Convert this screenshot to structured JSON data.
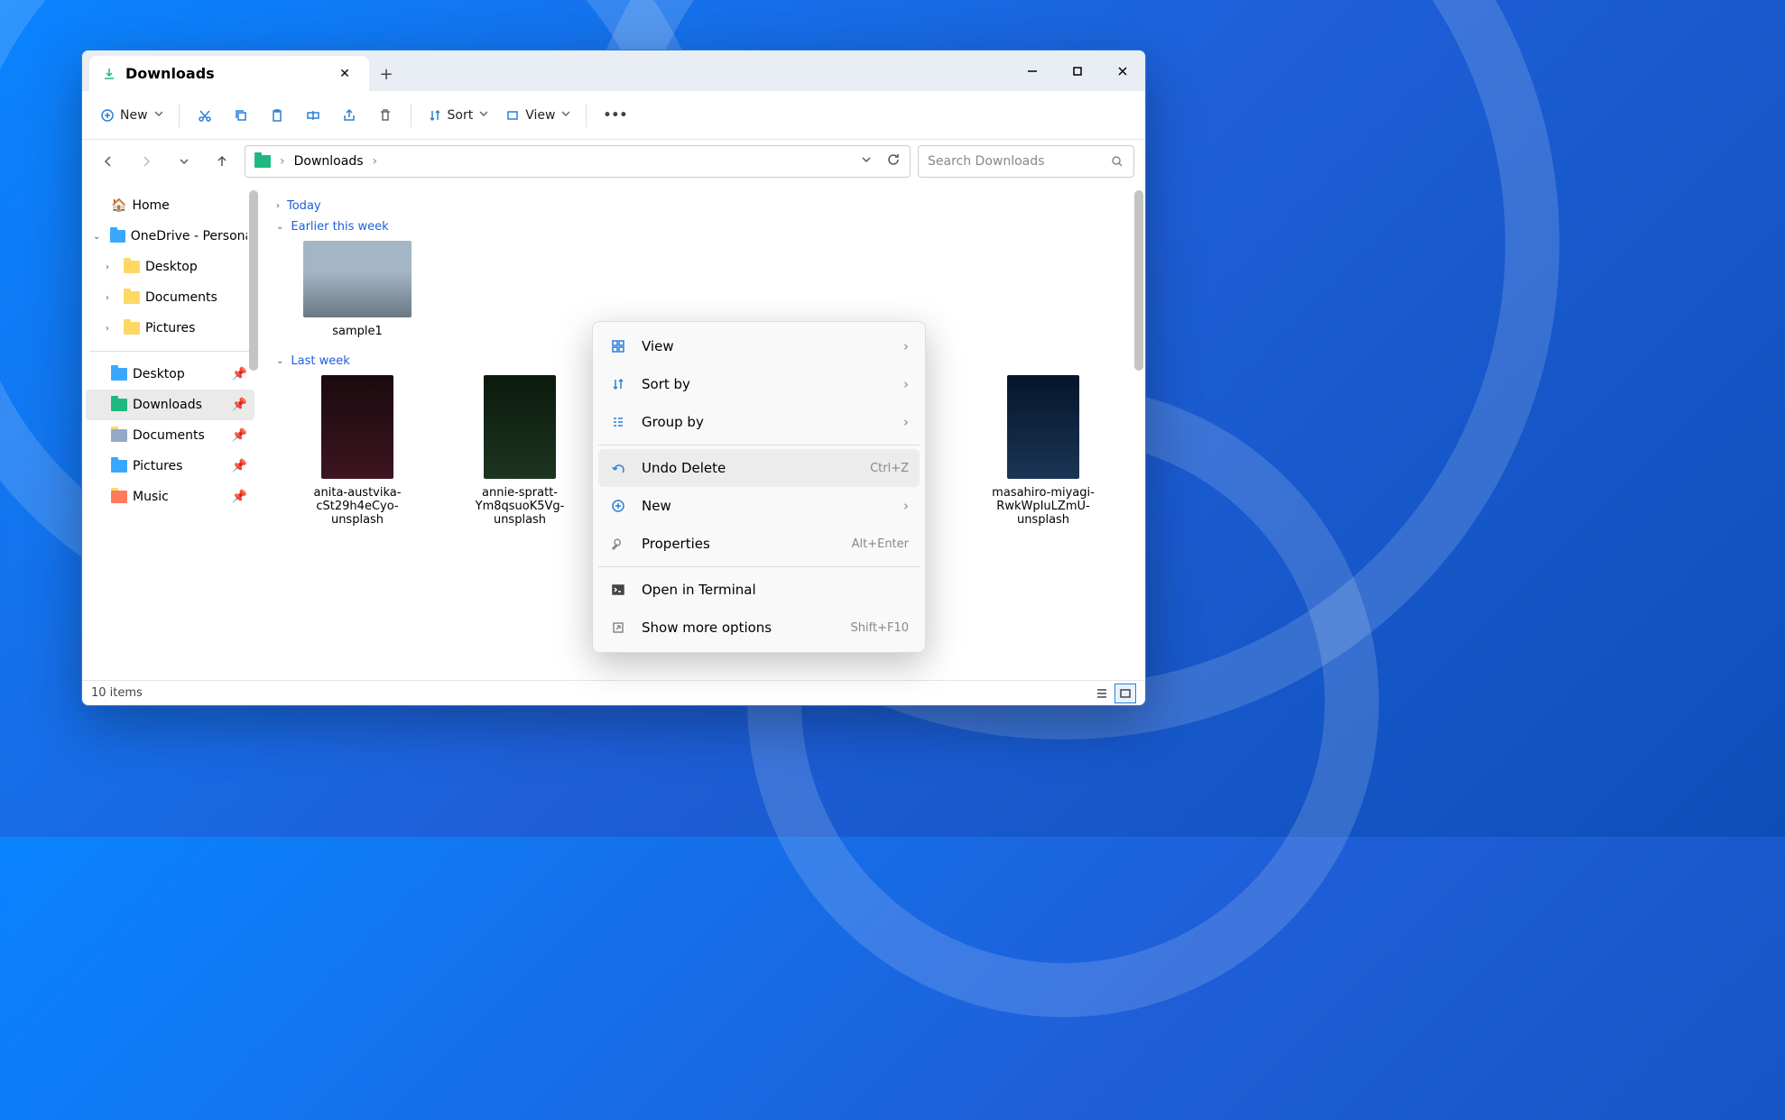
{
  "tab": {
    "title": "Downloads"
  },
  "toolbar": {
    "new": "New",
    "sort": "Sort",
    "view": "View"
  },
  "breadcrumb": {
    "root": "Downloads"
  },
  "search": {
    "placeholder": "Search Downloads"
  },
  "sidebar": {
    "home": "Home",
    "onedrive": "OneDrive - Personal",
    "desktop": "Desktop",
    "documents": "Documents",
    "pictures": "Pictures",
    "q_desktop": "Desktop",
    "q_downloads": "Downloads",
    "q_documents": "Documents",
    "q_pictures": "Pictures",
    "q_music": "Music"
  },
  "groups": {
    "today": "Today",
    "earlier": "Earlier this week",
    "lastweek": "Last week"
  },
  "files": {
    "sample1": "sample1",
    "anita": "anita-austvika-cSt29h4eCyo-unsplash",
    "annie": "annie-spratt-Ym8qsuoK5Vg-unsplash",
    "masahiro": "masahiro-miyagi-RwkWpIuLZmU-unsplash"
  },
  "ctx": {
    "view": "View",
    "sort": "Sort by",
    "group": "Group by",
    "undo": "Undo Delete",
    "undo_short": "Ctrl+Z",
    "new": "New",
    "props": "Properties",
    "props_short": "Alt+Enter",
    "terminal": "Open in Terminal",
    "more": "Show more options",
    "more_short": "Shift+F10"
  },
  "status": {
    "count": "10 items"
  }
}
